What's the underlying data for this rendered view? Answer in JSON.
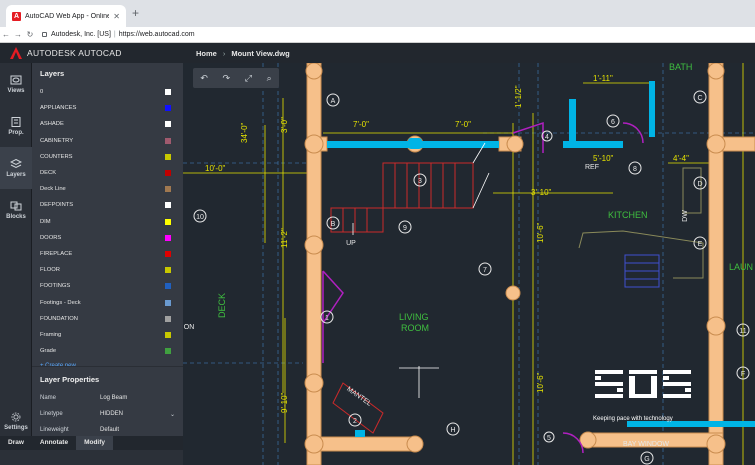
{
  "browser": {
    "tab_title": "AutoCAD Web App - Online CA",
    "url_org": "Autodesk, Inc. [US]",
    "url": "https://web.autocad.com"
  },
  "app": {
    "brand": "AUTODESK AUTOCAD",
    "breadcrumb_home": "Home",
    "breadcrumb_file": "Mount View.dwg"
  },
  "rail": [
    {
      "label": "Views",
      "icon": "eye-icon"
    },
    {
      "label": "Prop.",
      "icon": "properties-icon"
    },
    {
      "label": "Layers",
      "icon": "layers-icon"
    },
    {
      "label": "Blocks",
      "icon": "blocks-icon"
    },
    {
      "label": "Settings",
      "icon": "gear-icon"
    }
  ],
  "layers_panel": {
    "title": "Layers",
    "layers": [
      {
        "name": "0",
        "color": "#ffffff"
      },
      {
        "name": "APPLIANCES",
        "color": "#1010ff"
      },
      {
        "name": "ASHADE",
        "color": "#ffffff"
      },
      {
        "name": "CABINETRY",
        "color": "#a05a6e"
      },
      {
        "name": "COUNTERS",
        "color": "#c8c800"
      },
      {
        "name": "DECK",
        "color": "#c00000"
      },
      {
        "name": "Deck Line",
        "color": "#a07850"
      },
      {
        "name": "DEFPOINTS",
        "color": "#ffffff"
      },
      {
        "name": "DIM",
        "color": "#ffff00"
      },
      {
        "name": "DOORS",
        "color": "#ff00ff"
      },
      {
        "name": "FIREPLACE",
        "color": "#e00000"
      },
      {
        "name": "FLOOR",
        "color": "#c8c800"
      },
      {
        "name": "FOOTINGS",
        "color": "#2060c0"
      },
      {
        "name": "Footings - Deck",
        "color": "#6a9ad0"
      },
      {
        "name": "FOUNDATION",
        "color": "#a0a0a0"
      },
      {
        "name": "Framing",
        "color": "#c8c800"
      },
      {
        "name": "Grade",
        "color": "#40a040"
      }
    ],
    "create_new": "+ Create new"
  },
  "layer_properties": {
    "title": "Layer Properties",
    "rows": [
      {
        "key": "Name",
        "value": "Log Beam"
      },
      {
        "key": "Linetype",
        "value": "HIDDEN"
      },
      {
        "key": "Lineweight",
        "value": "Default"
      }
    ]
  },
  "bottom_tabs": [
    "Draw",
    "Annotate",
    "Modify"
  ],
  "toolbar_icons": [
    "undo-icon",
    "redo-icon",
    "fit-icon",
    "zoom-window-icon"
  ],
  "drawing": {
    "labels": {
      "kitchen": "KITCHEN",
      "living": "LIVING",
      "room": "ROOM",
      "deck": "DECK",
      "bath": "BATH",
      "ref": "REF",
      "up": "UP",
      "mantel": "MANTEL",
      "bay_window": "BAY WINDOW",
      "laundry": "LAUN",
      "dw": "DW",
      "on": "ON"
    },
    "dims": [
      "7'-0\"",
      "7'-0\"",
      "10'-0\"",
      "34'-0\"",
      "3'-0\"",
      "1'-11\"",
      "5'-10\"",
      "4'-4\"",
      "3'-10\"",
      "10'-6\"",
      "11'-2\"",
      "1'-1/2\"",
      "9'-10\"",
      "10'-6\""
    ],
    "bubbles": [
      "A",
      "B",
      "C",
      "D",
      "E",
      "F",
      "G",
      "H",
      "1",
      "2",
      "3",
      "4",
      "5",
      "6",
      "7",
      "8",
      "9",
      "10",
      "11"
    ]
  },
  "watermark": {
    "text": "Keeping pace with technology"
  }
}
